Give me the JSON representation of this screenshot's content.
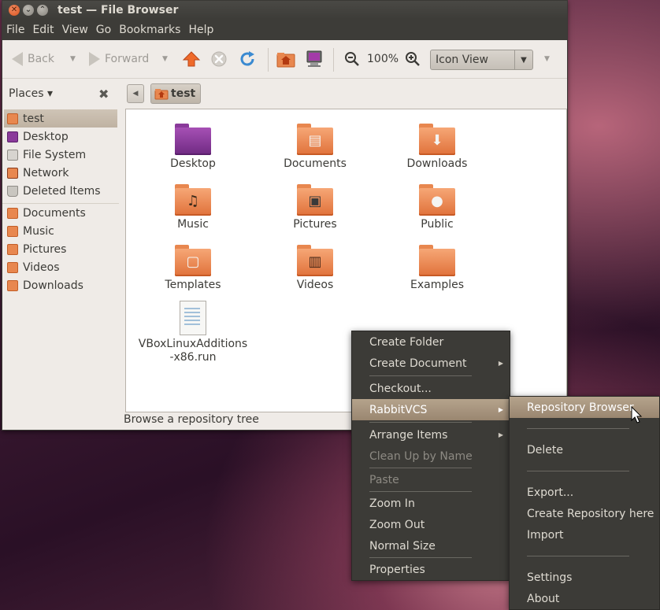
{
  "window": {
    "title": "test — File Browser",
    "controls": [
      "close",
      "minimize",
      "maximize"
    ]
  },
  "menubar": [
    "File",
    "Edit",
    "View",
    "Go",
    "Bookmarks",
    "Help"
  ],
  "toolbar": {
    "back": "Back",
    "forward": "Forward",
    "zoom_level": "100%",
    "view_mode": "Icon View"
  },
  "sidebar": {
    "header": "Places",
    "items": [
      {
        "label": "test",
        "icon": "home-folder-icon"
      },
      {
        "label": "Desktop",
        "icon": "desktop-icon"
      },
      {
        "label": "File System",
        "icon": "drive-icon"
      },
      {
        "label": "Network",
        "icon": "network-icon"
      },
      {
        "label": "Deleted Items",
        "icon": "trash-icon"
      },
      {
        "label": "Documents",
        "icon": "folder-icon"
      },
      {
        "label": "Music",
        "icon": "music-folder-icon"
      },
      {
        "label": "Pictures",
        "icon": "pictures-folder-icon"
      },
      {
        "label": "Videos",
        "icon": "videos-folder-icon"
      },
      {
        "label": "Downloads",
        "icon": "downloads-folder-icon"
      }
    ]
  },
  "pathbar": {
    "crumb": "test"
  },
  "files": [
    {
      "label": "Desktop",
      "icon": "desktop-folder-icon"
    },
    {
      "label": "Documents",
      "icon": "documents-folder-icon"
    },
    {
      "label": "Downloads",
      "icon": "downloads-folder-icon"
    },
    {
      "label": "Music",
      "icon": "music-folder-icon"
    },
    {
      "label": "Pictures",
      "icon": "pictures-folder-icon"
    },
    {
      "label": "Public",
      "icon": "public-folder-icon"
    },
    {
      "label": "Templates",
      "icon": "templates-folder-icon"
    },
    {
      "label": "Videos",
      "icon": "videos-folder-icon"
    },
    {
      "label": "Examples",
      "icon": "folder-icon"
    },
    {
      "label": "VBoxLinuxAdditions-x86.run",
      "icon": "script-file-icon"
    }
  ],
  "statusbar": "Browse a repository tree",
  "context_menu": [
    {
      "label": "Create Folder",
      "enabled": true
    },
    {
      "label": "Create Document",
      "enabled": true,
      "submenu": true
    },
    {
      "label": "Checkout...",
      "enabled": true
    },
    {
      "label": "RabbitVCS",
      "enabled": true,
      "submenu": true,
      "highlighted": true
    },
    {
      "label": "Arrange Items",
      "enabled": true,
      "submenu": true
    },
    {
      "label": "Clean Up by Name",
      "enabled": false
    },
    {
      "label": "Paste",
      "enabled": false
    },
    {
      "label": "Zoom In",
      "enabled": true
    },
    {
      "label": "Zoom Out",
      "enabled": true
    },
    {
      "label": "Normal Size",
      "enabled": true
    },
    {
      "label": "Properties",
      "enabled": true
    }
  ],
  "submenu_rabbitvcs": [
    {
      "label": "Repository Browser",
      "highlighted": true
    },
    {
      "label": "Delete"
    },
    {
      "label": "Export..."
    },
    {
      "label": "Create Repository here"
    },
    {
      "label": "Import"
    },
    {
      "label": "Settings"
    },
    {
      "label": "About"
    }
  ],
  "colors": {
    "title_bar": "#3d3c38",
    "menu_bg": "#3c3b37",
    "menu_highlight": "#a8957e",
    "window_bg": "#efebe7",
    "folder_orange": "#e8874f",
    "desktop_purple": "#7e3590"
  }
}
